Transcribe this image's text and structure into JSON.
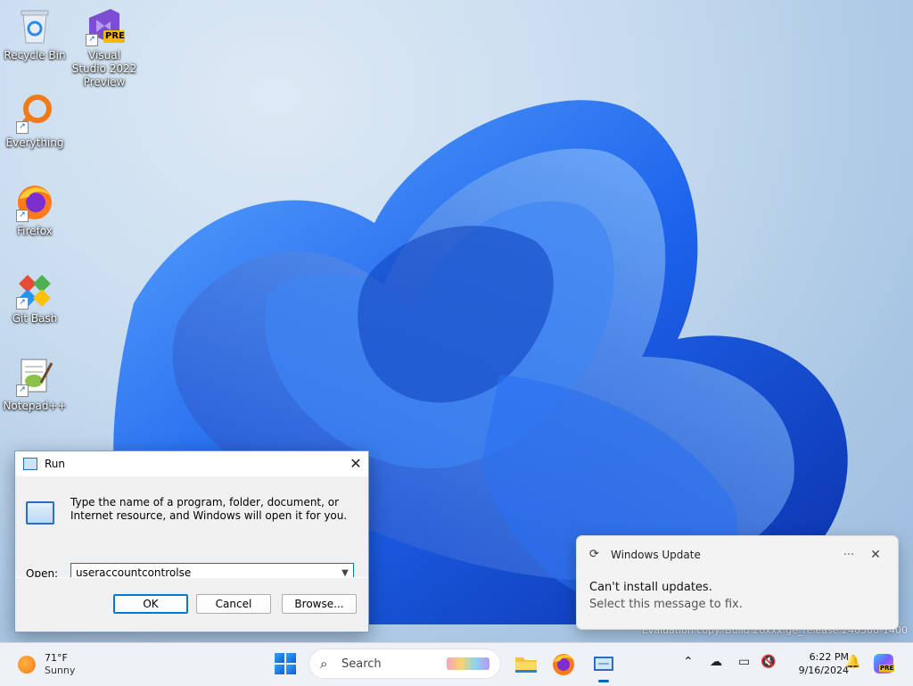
{
  "desktop": {
    "icons": [
      {
        "label": "Recycle Bin"
      },
      {
        "label": "Visual Studio 2022 Preview",
        "badge": "PRE"
      },
      {
        "label": "Everything"
      },
      {
        "label": "Firefox"
      },
      {
        "label": "Git Bash"
      },
      {
        "label": "Notepad++"
      }
    ],
    "watermark": "Evaluation copy. Build 26xxx.ge_release.240508-1400"
  },
  "run_dialog": {
    "title": "Run",
    "description": "Type the name of a program, folder, document, or Internet resource, and Windows will open it for you.",
    "open_label": "Open:",
    "open_value": "useraccountcontrolse",
    "ok_label": "OK",
    "cancel_label": "Cancel",
    "browse_label": "Browse..."
  },
  "toast": {
    "app": "Windows Update",
    "line1": "Can't install updates.",
    "line2": "Select this message to fix.",
    "more": "···",
    "close": "✕"
  },
  "taskbar": {
    "weather": {
      "temp": "71°F",
      "condition": "Sunny"
    },
    "search_placeholder": "Search",
    "clock": {
      "time": "6:22 PM",
      "date": "9/16/2024"
    },
    "copilot_badge": "PRE"
  },
  "colors": {
    "accent": "#0078d4",
    "wallpaper_blue": "#1f5fe0"
  }
}
